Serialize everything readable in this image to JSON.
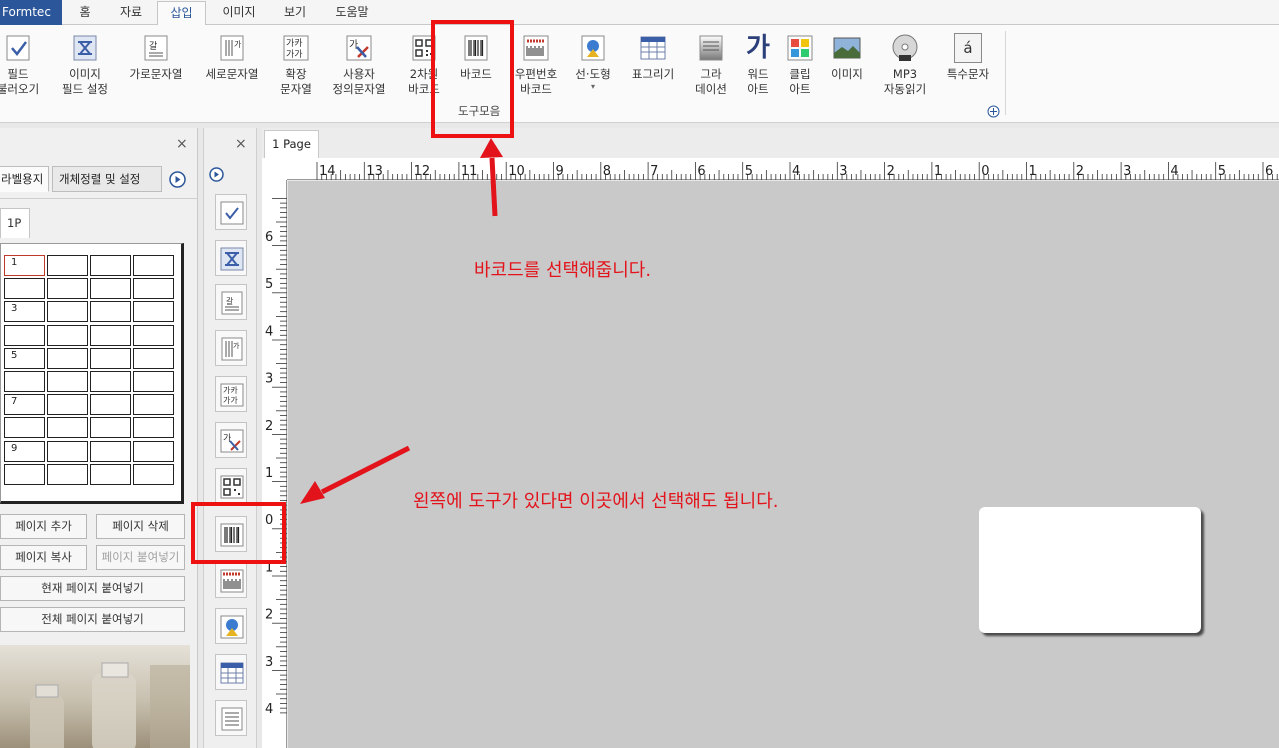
{
  "app": {
    "title": "Formtec"
  },
  "menu": {
    "tabs": [
      "홈",
      "자료",
      "삽입",
      "이미지",
      "보기",
      "도움말"
    ],
    "active": "삽입"
  },
  "ribbon": {
    "items": [
      {
        "line1": "필드",
        "line2": "불러오기",
        "icon": "field-load-icon"
      },
      {
        "line1": "이미지",
        "line2": "필드 설정",
        "icon": "image-field-icon"
      },
      {
        "line1": "가로문자열",
        "line2": "",
        "icon": "horizontal-text-icon"
      },
      {
        "line1": "세로문자열",
        "line2": "",
        "icon": "vertical-text-icon"
      },
      {
        "line1": "확장",
        "line2": "문자열",
        "icon": "extended-text-icon"
      },
      {
        "line1": "사용자",
        "line2": "정의문자열",
        "icon": "custom-text-icon"
      },
      {
        "line1": "2차원",
        "line2": "바코드",
        "icon": "qr-code-icon"
      },
      {
        "line1": "바코드",
        "line2": "",
        "icon": "barcode-icon"
      },
      {
        "line1": "우편번호",
        "line2": "바코드",
        "icon": "postal-barcode-icon"
      },
      {
        "line1": "선·도형",
        "line2": "▾",
        "icon": "shape-icon"
      },
      {
        "line1": "표그리기",
        "line2": "",
        "icon": "table-icon"
      },
      {
        "line1": "그라",
        "line2": "데이션",
        "icon": "gradation-icon"
      },
      {
        "line1": "워드",
        "line2": "아트",
        "icon": "word-art-icon"
      },
      {
        "line1": "클립",
        "line2": "아트",
        "icon": "clip-art-icon"
      },
      {
        "line1": "이미지",
        "line2": "",
        "icon": "image-icon"
      },
      {
        "line1": "MP3",
        "line2": "자동읽기",
        "icon": "mp3-icon"
      },
      {
        "line1": "특수문자",
        "line2": "",
        "icon": "special-char-icon"
      }
    ],
    "group_label": "도구모음",
    "special_char_glyph": "á",
    "word_art_glyph": "가"
  },
  "left_panel": {
    "close": "×",
    "tabs": [
      "라벨용지",
      "개체정렬 및 설정"
    ],
    "page_tab": "1P",
    "grid_rows": 10,
    "grid_cols": 4,
    "row_labels": [
      "1",
      "",
      "3",
      "",
      "5",
      "",
      "7",
      "",
      "9",
      ""
    ],
    "buttons": {
      "add_page": "페이지 추가",
      "delete_page": "페이지 삭제",
      "copy_page": "페이지 복사",
      "paste_page": "페이지 붙여넣기",
      "paste_current": "현재 페이지 붙여넣기",
      "paste_all": "전체 페이지 붙여넣기"
    }
  },
  "toolbox": {
    "close": "×"
  },
  "document": {
    "tab": "1 Page",
    "h_ruler_labels": [
      "14",
      "13",
      "12",
      "11",
      "10",
      "9",
      "8",
      "7",
      "6",
      "5",
      "4",
      "3",
      "2",
      "1",
      "0",
      "1",
      "2",
      "3",
      "4",
      "5",
      "6"
    ],
    "v_ruler_labels": [
      "6",
      "5",
      "4",
      "3",
      "2",
      "1",
      "0",
      "1",
      "2",
      "3",
      "4"
    ]
  },
  "annotations": {
    "top": "바코드를 선택해줍니다.",
    "left": "왼쪽에 도구가 있다면 이곳에서 선택해도 됩니다.",
    "color": "#e3131b"
  }
}
